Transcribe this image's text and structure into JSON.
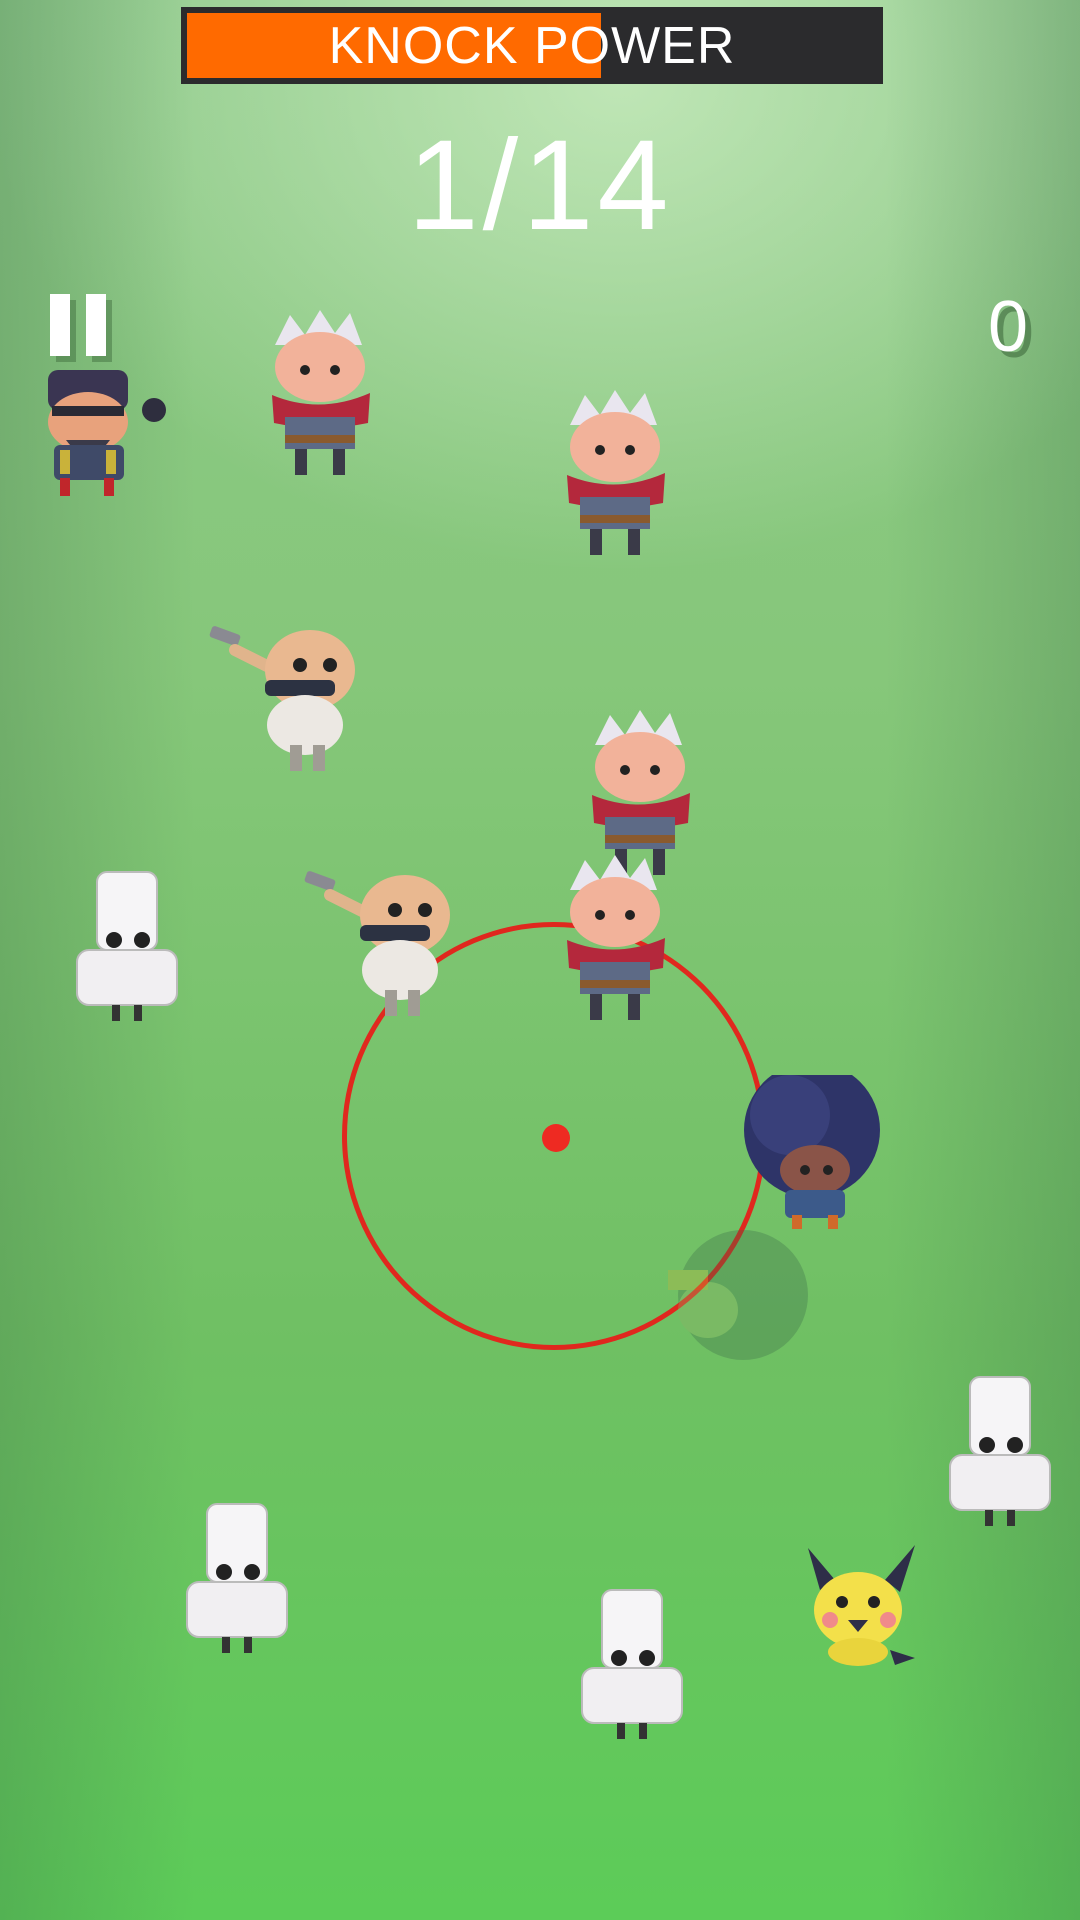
{
  "hud": {
    "power_label": "KNOCK POWER",
    "power_level": 0.6,
    "power_color": "#ff6a00",
    "progress": "1/14",
    "score": "0",
    "pause_icon": "pause-icon"
  },
  "target": {
    "ring_color": "#e0281e"
  },
  "characters": [
    "pirate-bomber",
    "white-haired-bandit",
    "bald-gunman",
    "paper-bag-scientist",
    "afro-character",
    "ghost-afro-character",
    "pikachu-like-creature"
  ]
}
